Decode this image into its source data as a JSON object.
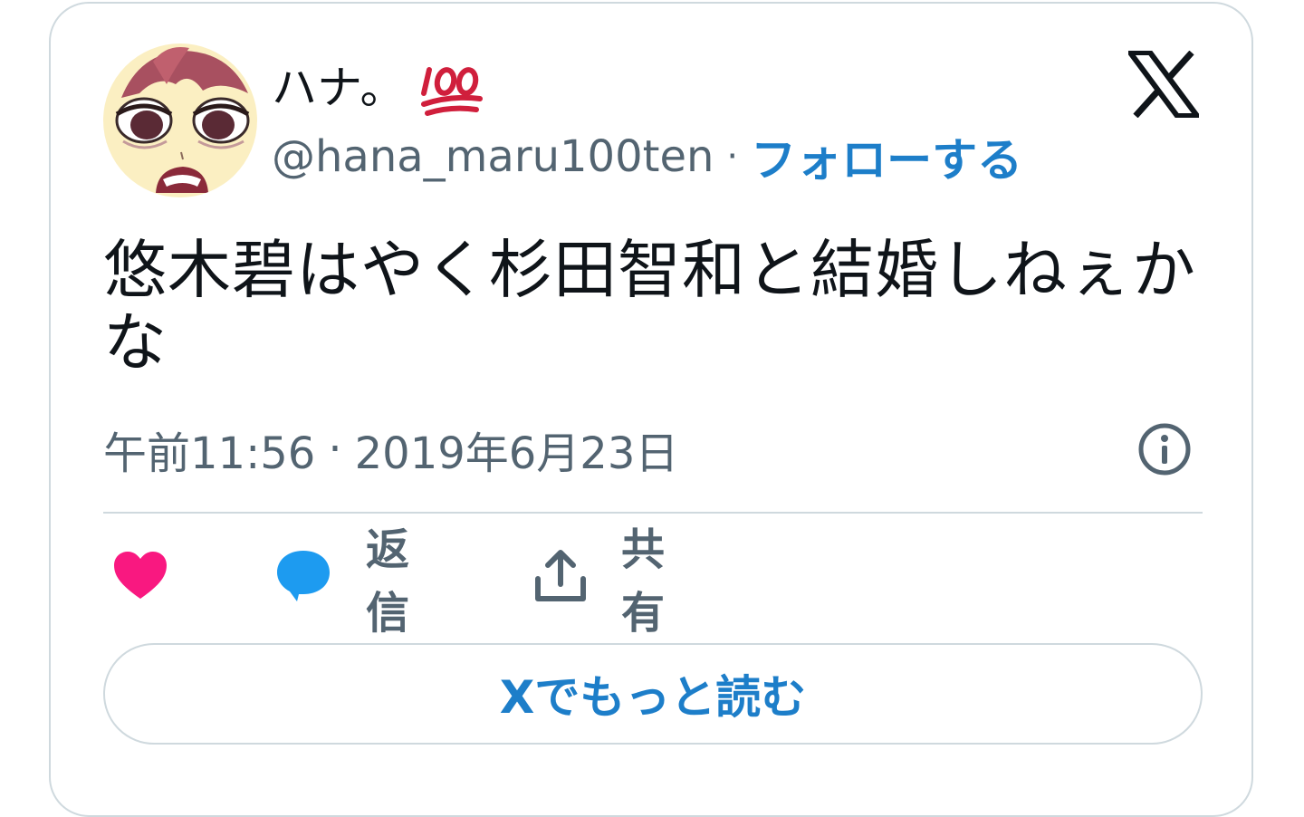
{
  "author": {
    "display_name": "ハナ。",
    "emoji_icon": "hundred-points-icon",
    "handle": "@hana_maru100ten",
    "separator": "·",
    "follow_label": "フォローする"
  },
  "tweet": {
    "text": "悠木碧はやく杉田智和と結婚しねぇかな",
    "time": "午前11:56",
    "separator": "·",
    "date": "2019年6月23日"
  },
  "actions": {
    "like_icon": "heart-icon",
    "reply_label": "返信",
    "share_label": "共有"
  },
  "read_more_label": "Xでもっと読む",
  "colors": {
    "accent": "#1d7ec9",
    "like": "#f91880",
    "reply": "#1d9bf0",
    "secondary_text": "#536471",
    "border": "#cfd9de"
  }
}
